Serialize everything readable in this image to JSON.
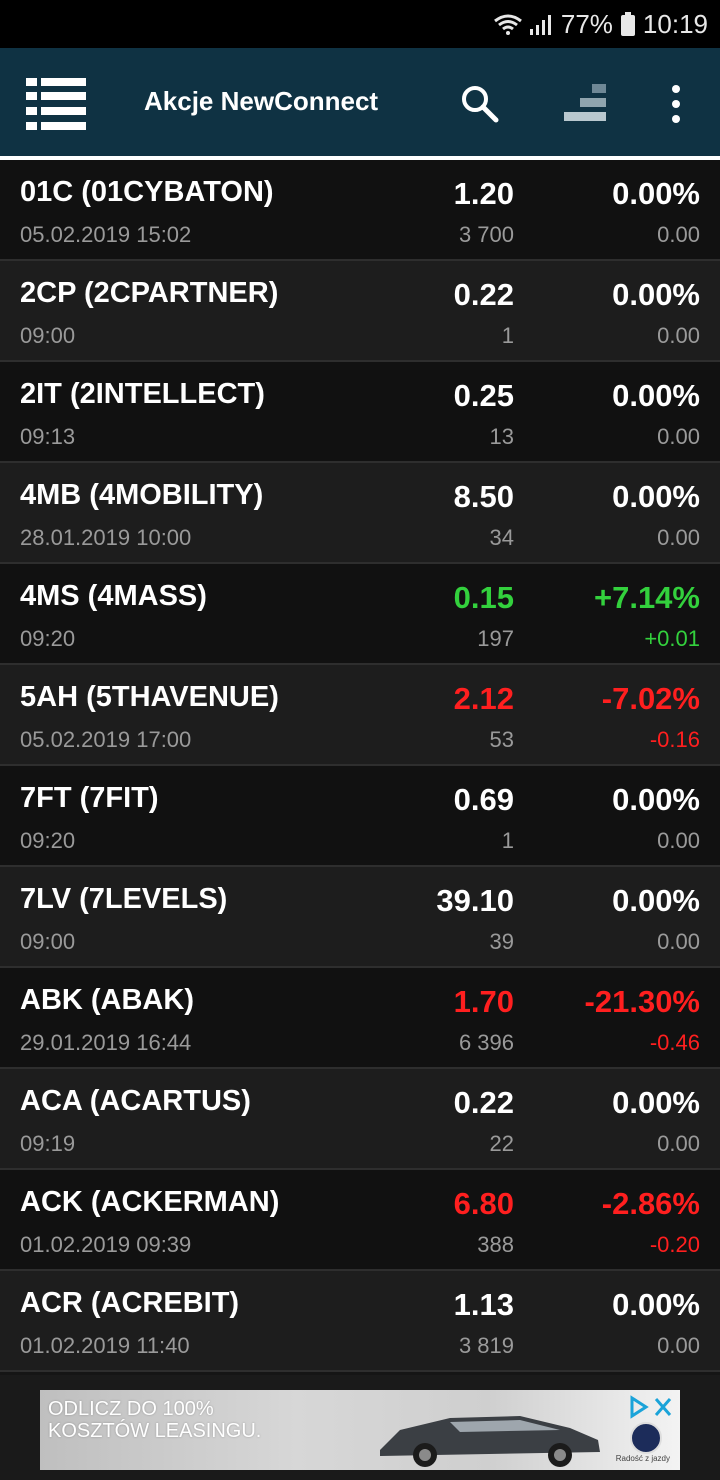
{
  "status": {
    "battery": "77%",
    "time": "10:19"
  },
  "app_bar": {
    "title": "Akcje NewConnect",
    "icons": [
      "menu-icon",
      "search-icon",
      "sort-icon",
      "more-vert-icon"
    ],
    "background": "#0f3243"
  },
  "colors": {
    "up": "#33d13d",
    "down": "#ff1f1f",
    "neutral": "#ffffff",
    "secondary": "#9a9a9a"
  },
  "stocks": [
    {
      "name": "01C (01CYBATON)",
      "time": "05.02.2019 15:02",
      "price": "1.20",
      "volume": "3 700",
      "change": "0.00%",
      "abs": "0.00",
      "trend": "flat"
    },
    {
      "name": "2CP (2CPARTNER)",
      "time": "09:00",
      "price": "0.22",
      "volume": "1",
      "change": "0.00%",
      "abs": "0.00",
      "trend": "flat"
    },
    {
      "name": "2IT (2INTELLECT)",
      "time": "09:13",
      "price": "0.25",
      "volume": "13",
      "change": "0.00%",
      "abs": "0.00",
      "trend": "flat"
    },
    {
      "name": "4MB (4MOBILITY)",
      "time": "28.01.2019 10:00",
      "price": "8.50",
      "volume": "34",
      "change": "0.00%",
      "abs": "0.00",
      "trend": "flat"
    },
    {
      "name": "4MS (4MASS)",
      "time": "09:20",
      "price": "0.15",
      "volume": "197",
      "change": "+7.14%",
      "abs": "+0.01",
      "trend": "up"
    },
    {
      "name": "5AH (5THAVENUE)",
      "time": "05.02.2019 17:00",
      "price": "2.12",
      "volume": "53",
      "change": "-7.02%",
      "abs": "-0.16",
      "trend": "down"
    },
    {
      "name": "7FT (7FIT)",
      "time": "09:20",
      "price": "0.69",
      "volume": "1",
      "change": "0.00%",
      "abs": "0.00",
      "trend": "flat"
    },
    {
      "name": "7LV (7LEVELS)",
      "time": "09:00",
      "price": "39.10",
      "volume": "39",
      "change": "0.00%",
      "abs": "0.00",
      "trend": "flat"
    },
    {
      "name": "ABK (ABAK)",
      "time": "29.01.2019 16:44",
      "price": "1.70",
      "volume": "6 396",
      "change": "-21.30%",
      "abs": "-0.46",
      "trend": "down"
    },
    {
      "name": "ACA (ACARTUS)",
      "time": "09:19",
      "price": "0.22",
      "volume": "22",
      "change": "0.00%",
      "abs": "0.00",
      "trend": "flat"
    },
    {
      "name": "ACK (ACKERMAN)",
      "time": "01.02.2019 09:39",
      "price": "6.80",
      "volume": "388",
      "change": "-2.86%",
      "abs": "-0.20",
      "trend": "down"
    },
    {
      "name": "ACR (ACREBIT)",
      "time": "01.02.2019 11:40",
      "price": "1.13",
      "volume": "3 819",
      "change": "0.00%",
      "abs": "0.00",
      "trend": "flat"
    }
  ],
  "ad": {
    "text_line1": "ODLICZ DO 100%",
    "text_line2": "KOSZTÓW LEASINGU.",
    "logo_caption": "Radość z jazdy",
    "icons": [
      "adchoices-icon",
      "close-icon",
      "car-image",
      "brand-logo"
    ]
  }
}
